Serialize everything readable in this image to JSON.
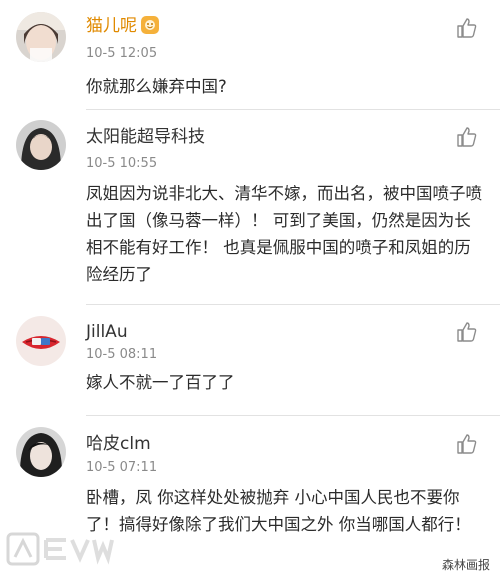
{
  "comments": [
    {
      "username": "猫儿呢",
      "time": "10-5 12:05",
      "text": "你就那么嫌弃中国?"
    },
    {
      "username": "太阳能超导科技",
      "time": "10-5 10:55",
      "text": "凤姐因为说非北大、清华不嫁，而出名，被中国喷子喷出了国（像马蓉一样）！  可到了美国，仍然是因为长相不能有好工作！  也真是佩服中国的喷子和凤姐的历险经历了"
    },
    {
      "username": "JillAu",
      "time": "10-5 08:11",
      "text": "嫁人不就一了百了了"
    },
    {
      "username": "哈皮clm",
      "time": "10-5 07:11",
      "text": "卧槽，凤 你这样处处被抛弃 小心中国人民也不要你了！搞得好像除了我们大中国之外 你当哪国人都行！"
    }
  ],
  "icons": {
    "like": "thumbs-up-icon",
    "badge": "vip-badge-icon"
  },
  "colors": {
    "username_highlight": "#e08a00",
    "time": "#8a8a8a",
    "divider": "#e2e2e2"
  },
  "watermark": {
    "right_text": "森林画报"
  }
}
